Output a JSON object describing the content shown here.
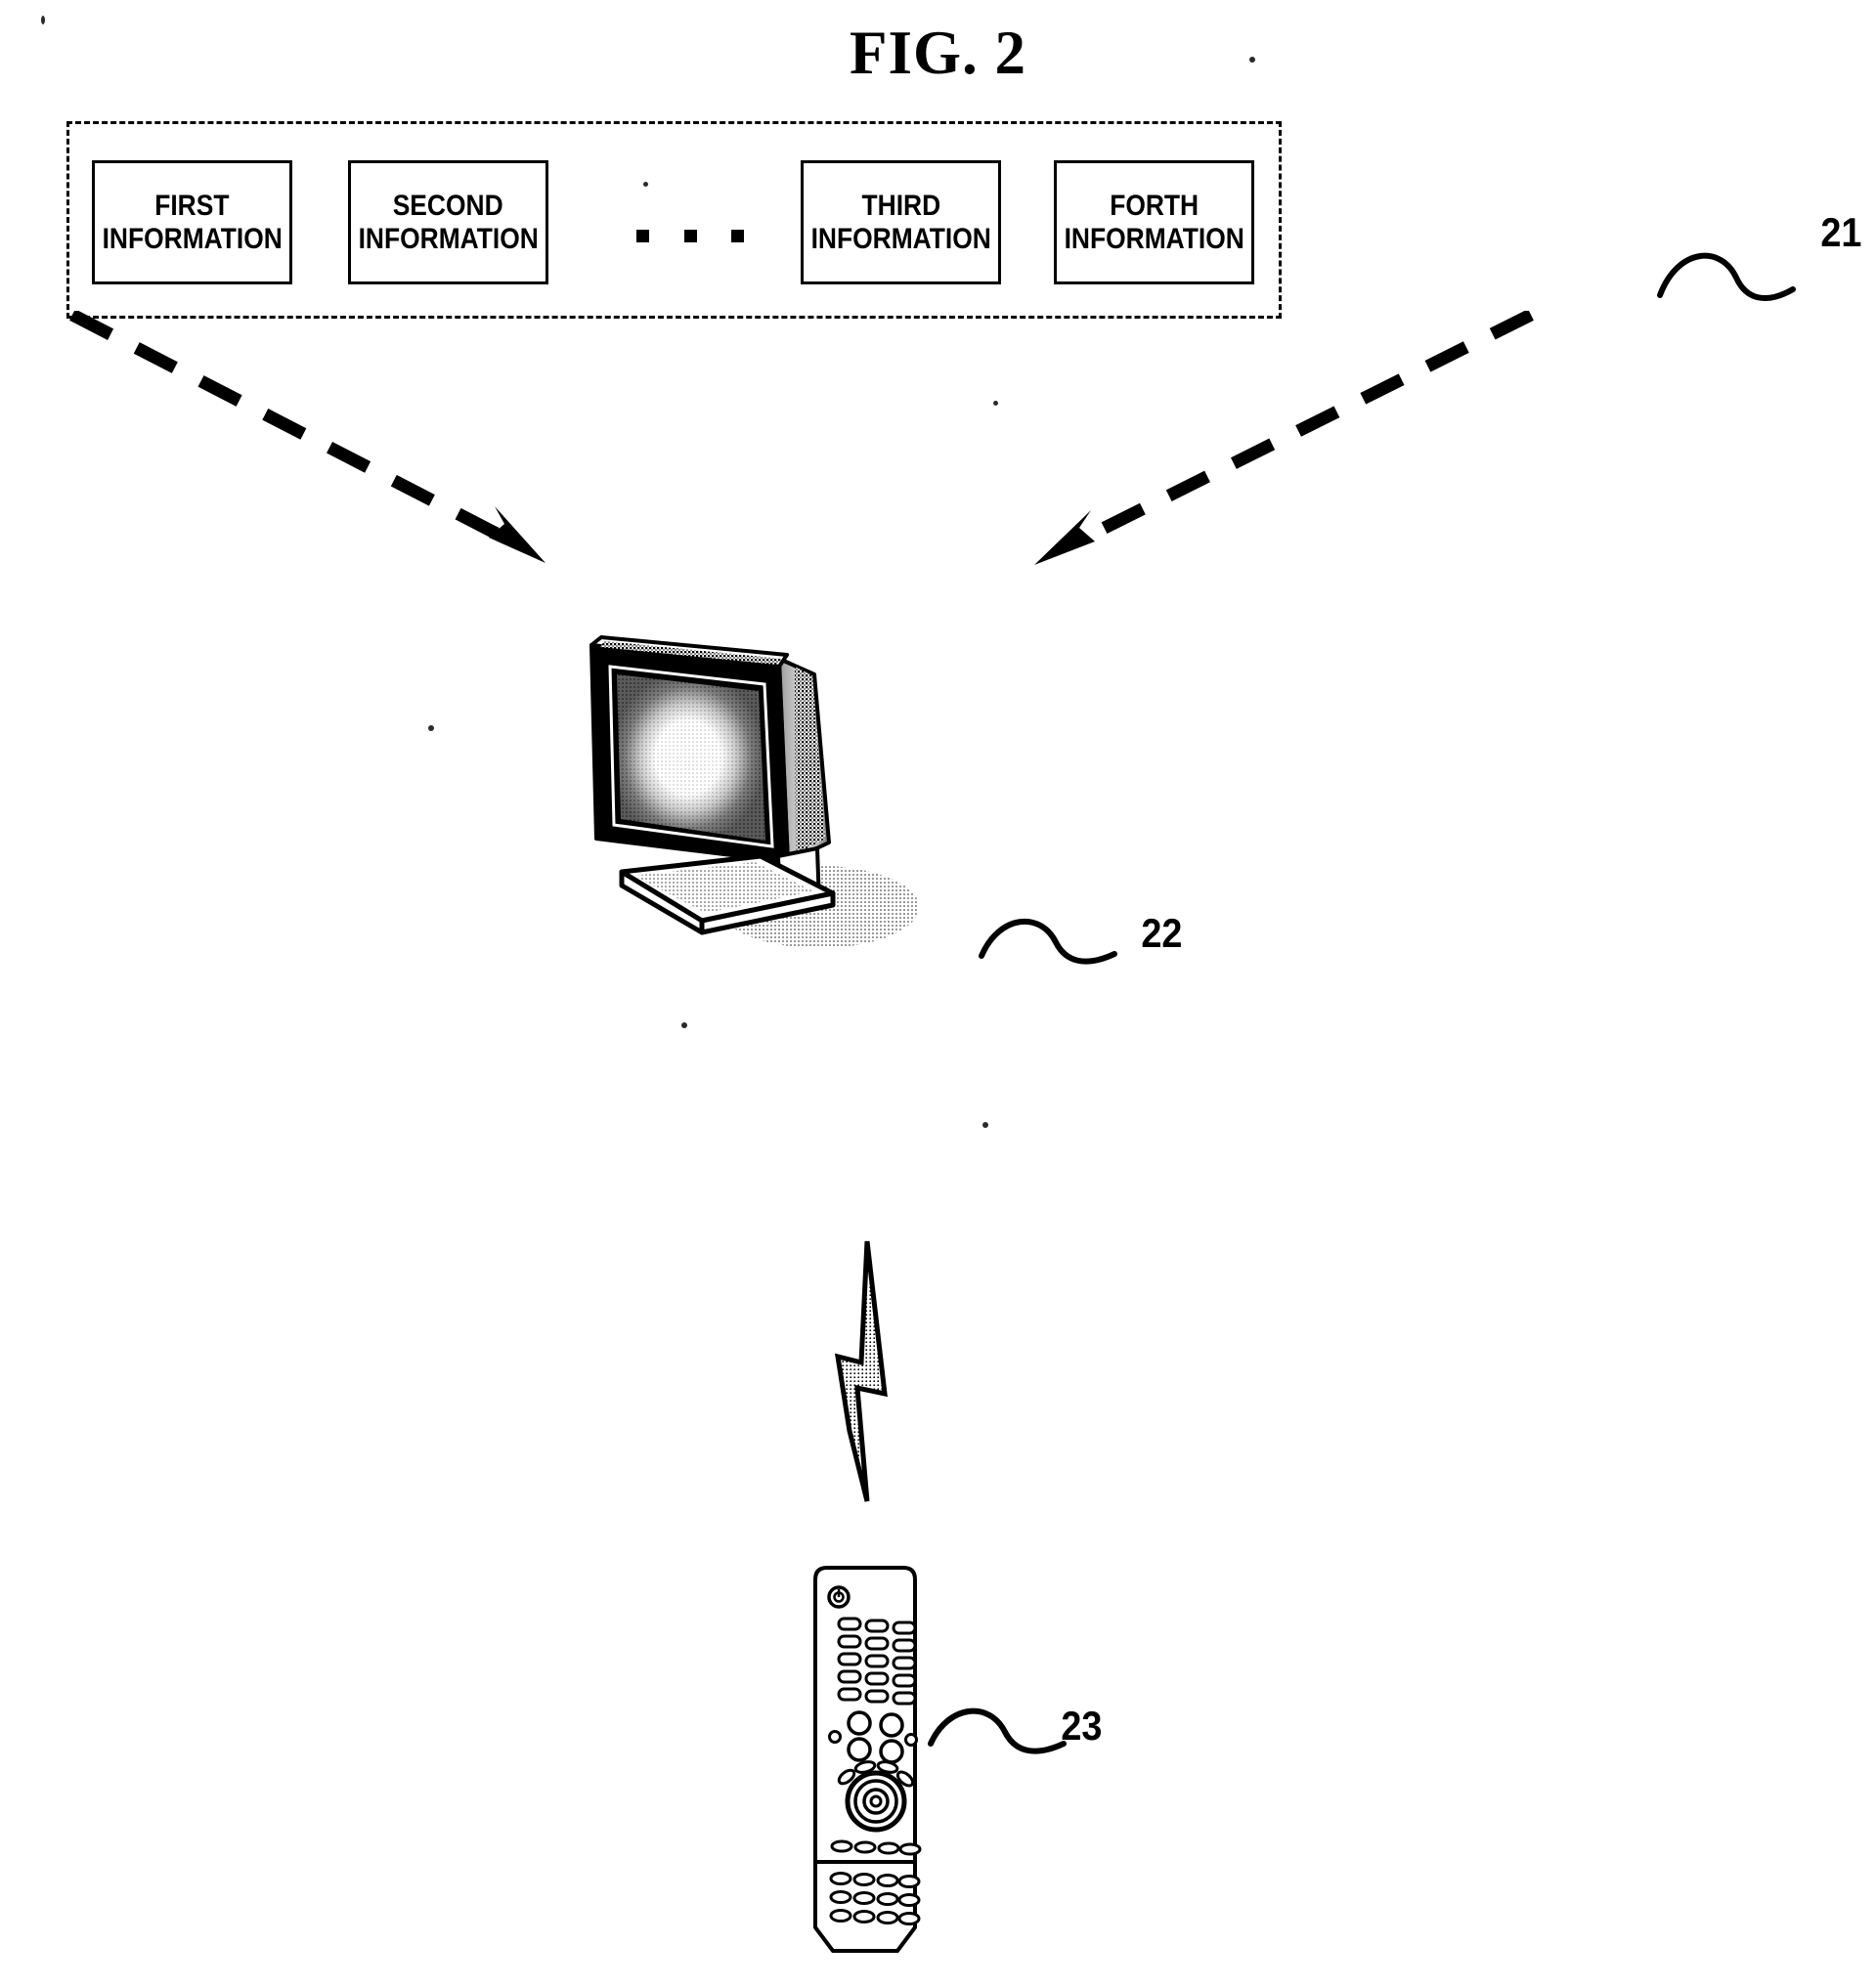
{
  "figure": {
    "title": "FIG. 2"
  },
  "information_group": {
    "reference_numeral": "21",
    "boxes": [
      {
        "line1": "FIRST",
        "line2": "INFORMATION"
      },
      {
        "line1": "SECOND",
        "line2": "INFORMATION"
      },
      {
        "line1": "THIRD",
        "line2": "INFORMATION"
      },
      {
        "line1": "FORTH",
        "line2": "INFORMATION"
      }
    ],
    "ellipsis_dot_count": 3
  },
  "display_device": {
    "reference_numeral": "22",
    "icon": "television-monitor-icon"
  },
  "signal": {
    "icon": "lightning-bolt-icon"
  },
  "remote_control": {
    "reference_numeral": "23",
    "icon": "remote-control-icon"
  },
  "arrows": {
    "left": "dashed-arrow-down-right",
    "right": "dashed-arrow-down-left"
  },
  "colors": {
    "ink": "#000000",
    "paper": "#ffffff"
  }
}
